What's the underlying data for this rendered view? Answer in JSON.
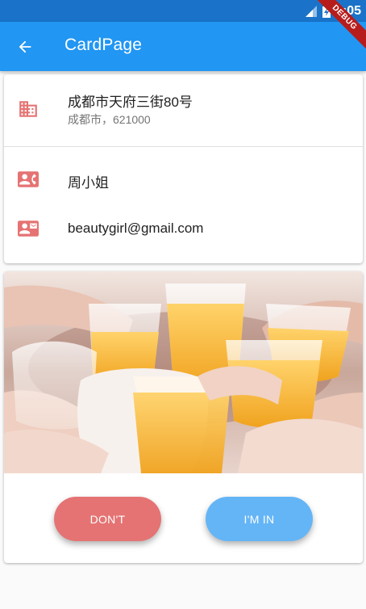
{
  "status_bar": {
    "time": "3:05"
  },
  "app_bar": {
    "title": "CardPage",
    "debug_label": "DEBUG"
  },
  "contact_card": {
    "address_line1": "成都市天府三街80号",
    "address_line2": "成都市，621000",
    "name": "周小姐",
    "email": "beautygirl@gmail.com",
    "icon_color": "#e57373"
  },
  "photo_card": {
    "dont_label": "DON'T",
    "im_in_label": "I'M IN",
    "dont_color": "#e57373",
    "im_in_color": "#64b5f6"
  },
  "colors": {
    "primary": "#2196f3",
    "status_bar": "#1a73c8"
  }
}
